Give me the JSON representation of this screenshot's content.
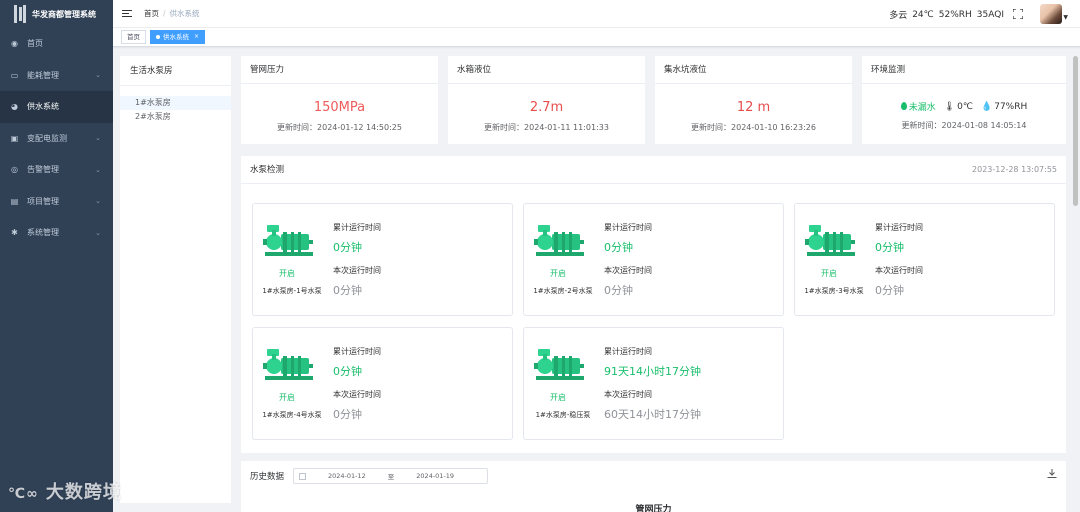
{
  "app": {
    "title": "华发商都管理系统"
  },
  "sidebar": {
    "items": [
      {
        "label": "首页",
        "icon": "dashboard-icon",
        "glyph": "◉",
        "active": false,
        "has_children": false
      },
      {
        "label": "能耗管理",
        "icon": "monitor-icon",
        "glyph": "▭",
        "active": false,
        "has_children": true
      },
      {
        "label": "供水系统",
        "icon": "globe-icon",
        "glyph": "◕",
        "active": true,
        "has_children": false
      },
      {
        "label": "变配电监测",
        "icon": "camera-icon",
        "glyph": "▣",
        "active": false,
        "has_children": true
      },
      {
        "label": "告警管理",
        "icon": "alarm-icon",
        "glyph": "◎",
        "active": false,
        "has_children": true
      },
      {
        "label": "项目管理",
        "icon": "document-icon",
        "glyph": "▤",
        "active": false,
        "has_children": true
      },
      {
        "label": "系统管理",
        "icon": "gear-icon",
        "glyph": "✱",
        "active": false,
        "has_children": true
      }
    ]
  },
  "header": {
    "breadcrumb": [
      "首页",
      "供水系统"
    ],
    "weather": {
      "condition": "多云",
      "temp": "24℃",
      "humidity": "52%RH",
      "aqi": "35AQI"
    }
  },
  "tabs": [
    {
      "label": "首页",
      "active": false
    },
    {
      "label": "供水系统",
      "active": true
    }
  ],
  "tree": {
    "title": "生活水泵房",
    "items": [
      "1#水泵房",
      "2#水泵房"
    ]
  },
  "metrics": {
    "pressure": {
      "title": "管网压力",
      "value": "150MPa",
      "time": "更新时间：2024-01-12 14:50:25"
    },
    "tank": {
      "title": "水箱液位",
      "value": "2.7m",
      "time": "更新时间：2024-01-11 11:01:33"
    },
    "pit": {
      "title": "集水坑液位",
      "value": "12 m",
      "time": "更新时间：2024-01-10 16:23:26"
    },
    "env": {
      "title": "环境监测",
      "leak": "未漏水",
      "temp": "0℃",
      "humidity": "77%RH",
      "time": "更新时间：2024-01-08 14:05:14"
    }
  },
  "pump_section": {
    "title": "水泵检测",
    "timestamp": "2023-12-28 13:07:55",
    "label_total": "累计运行时间",
    "label_current": "本次运行时间",
    "pumps": [
      {
        "name": "1#水泵房-1号水泵",
        "state": "开启",
        "total": "0分钟",
        "current": "0分钟"
      },
      {
        "name": "1#水泵房-2号水泵",
        "state": "开启",
        "total": "0分钟",
        "current": "0分钟"
      },
      {
        "name": "1#水泵房-3号水泵",
        "state": "开启",
        "total": "0分钟",
        "current": "0分钟"
      },
      {
        "name": "1#水泵房-4号水泵",
        "state": "开启",
        "total": "0分钟",
        "current": "0分钟"
      },
      {
        "name": "1#水泵房-稳压泵",
        "state": "开启",
        "total": "91天14小时17分钟",
        "current": "60天14小时17分钟"
      }
    ]
  },
  "history": {
    "title": "历史数据",
    "start": "2024-01-12",
    "sep": "至",
    "end": "2024-01-19",
    "chart_title": "管网压力"
  },
  "watermark": "大数跨境",
  "colors": {
    "sidebar_bg": "#304156",
    "accent": "#409eff",
    "green": "#19be6b",
    "red": "#e74c4c"
  }
}
